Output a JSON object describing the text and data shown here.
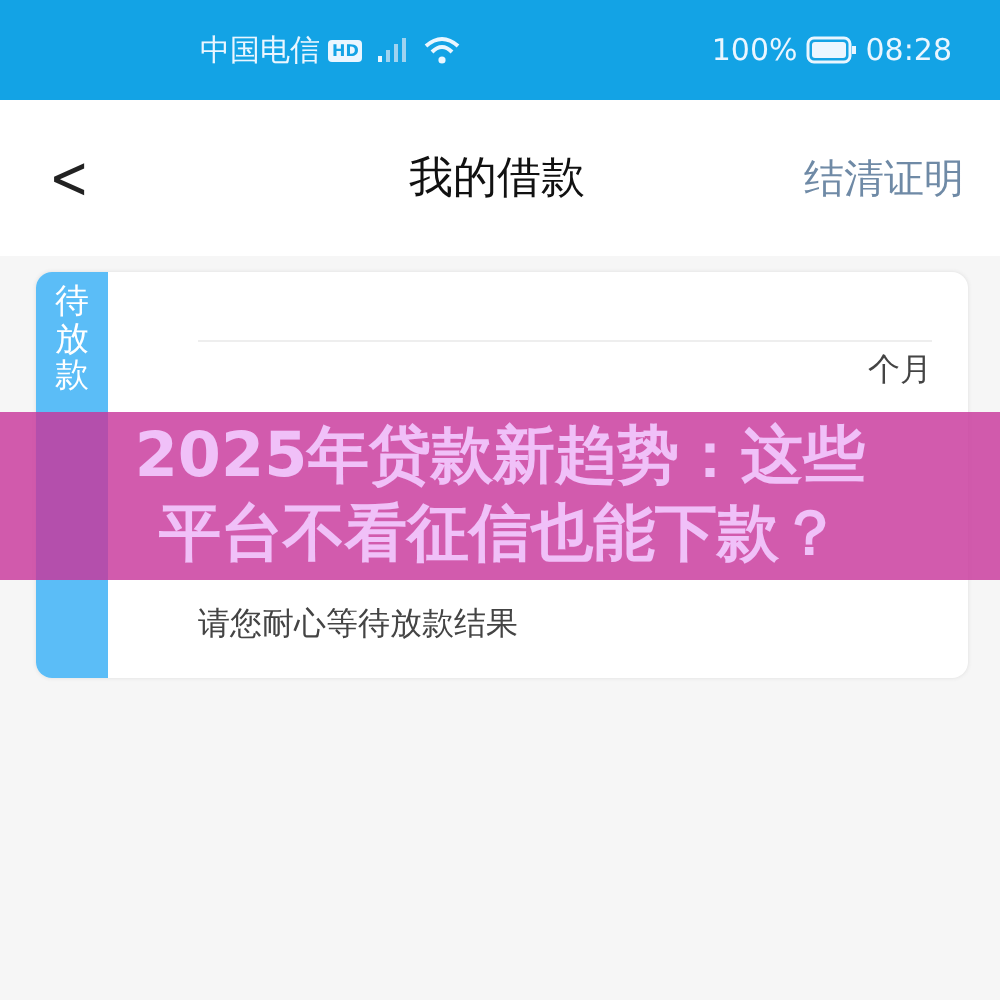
{
  "status_bar": {
    "carrier": "中国电信",
    "hd_badge": "HD",
    "battery_percent": "100%",
    "time": "08:28"
  },
  "nav": {
    "back": "<",
    "title": "我的借款",
    "action": "结清证明"
  },
  "loan_card": {
    "status_tab": "待放款",
    "term_text": "个月",
    "message": "请您耐心等待放款结果"
  },
  "banner": {
    "lines": [
      "2025年贷款新趋势：这些",
      "平台不看征信也能下款？"
    ]
  }
}
